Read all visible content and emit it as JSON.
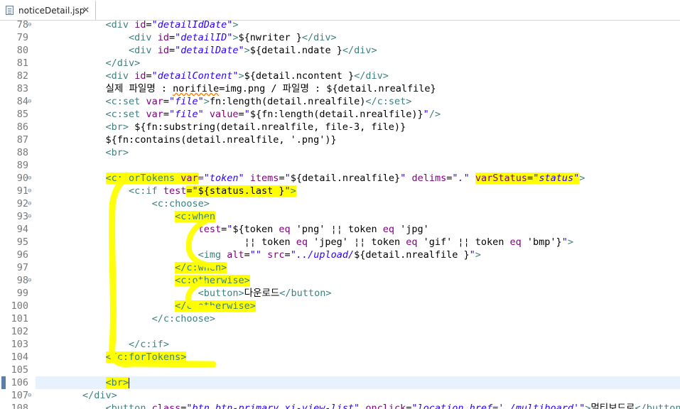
{
  "tab": {
    "title": "noticeDetail.jsp",
    "close": "✕",
    "icon": "jsp-file-icon"
  },
  "lines": [
    {
      "n": "78",
      "fold": true,
      "indent": "            ",
      "tokens": [
        [
          "tg",
          "<div "
        ],
        [
          "at",
          "id"
        ],
        [
          "el",
          "="
        ],
        [
          "sv",
          "\"detailIdDate\""
        ],
        [
          "tg",
          ">"
        ]
      ]
    },
    {
      "n": "79",
      "indent": "                ",
      "tokens": [
        [
          "tg",
          "<div "
        ],
        [
          "at",
          "id"
        ],
        [
          "el",
          "="
        ],
        [
          "sv",
          "\"detailID\""
        ],
        [
          "tg",
          ">"
        ],
        [
          "el",
          "${nwriter }"
        ],
        [
          "tg",
          "</div>"
        ]
      ]
    },
    {
      "n": "80",
      "indent": "                ",
      "tokens": [
        [
          "tg",
          "<div "
        ],
        [
          "at",
          "id"
        ],
        [
          "el",
          "="
        ],
        [
          "sv",
          "\"detailDate\""
        ],
        [
          "tg",
          ">"
        ],
        [
          "el",
          "${detail.ndate }"
        ],
        [
          "tg",
          "</div>"
        ]
      ]
    },
    {
      "n": "81",
      "indent": "            ",
      "tokens": [
        [
          "tg",
          "</div>"
        ]
      ]
    },
    {
      "n": "82",
      "indent": "            ",
      "tokens": [
        [
          "tg",
          "<div "
        ],
        [
          "at",
          "id"
        ],
        [
          "el",
          "="
        ],
        [
          "sv",
          "\"detailContent\""
        ],
        [
          "tg",
          ">"
        ],
        [
          "el",
          "${detail.ncontent }"
        ],
        [
          "tg",
          "</div>"
        ]
      ]
    },
    {
      "n": "83",
      "indent": "            ",
      "tokens": [
        [
          "el",
          "실제 파일명 : "
        ],
        [
          "el sq",
          "norifile"
        ],
        [
          "el",
          "=img.png / 파일명 : ${detail.nrealfile}"
        ]
      ]
    },
    {
      "n": "84",
      "fold": true,
      "indent": "            ",
      "tokens": [
        [
          "tg",
          "<c:set "
        ],
        [
          "at",
          "var"
        ],
        [
          "el",
          "="
        ],
        [
          "sv",
          "\"file\""
        ],
        [
          "tg",
          ">"
        ],
        [
          "el",
          "fn:length(detail.nrealfile)"
        ],
        [
          "tg",
          "</c:set>"
        ]
      ]
    },
    {
      "n": "85",
      "indent": "            ",
      "tokens": [
        [
          "tg",
          "<c:set "
        ],
        [
          "at",
          "var"
        ],
        [
          "el",
          "="
        ],
        [
          "sv",
          "\"file\""
        ],
        [
          "el",
          " "
        ],
        [
          "at",
          "value"
        ],
        [
          "el",
          "="
        ],
        [
          "sv",
          "\""
        ],
        [
          "el",
          "${fn:length(detail.nrealfile)}"
        ],
        [
          "sv",
          "\""
        ],
        [
          "tg",
          "/>"
        ]
      ]
    },
    {
      "n": "86",
      "indent": "            ",
      "tokens": [
        [
          "tg",
          "<br>"
        ],
        [
          "el",
          " ${fn:substring(detail.nrealfile, file-3, file)}"
        ]
      ]
    },
    {
      "n": "87",
      "indent": "            ",
      "tokens": [
        [
          "el",
          "${fn:contains(detail.nrealfile, '.png')}"
        ]
      ]
    },
    {
      "n": "88",
      "indent": "            ",
      "tokens": [
        [
          "tg",
          "<br>"
        ]
      ]
    },
    {
      "n": "89",
      "indent": "",
      "tokens": []
    },
    {
      "n": "90",
      "fold": true,
      "indent": "            ",
      "tokens": [
        [
          "tg hl",
          "<c:forTokens "
        ],
        [
          "at hl",
          "var"
        ],
        [
          "at",
          "="
        ],
        [
          "sv",
          "\"token\""
        ],
        [
          "el",
          " "
        ],
        [
          "at",
          "items"
        ],
        [
          "el",
          "="
        ],
        [
          "sv",
          "\""
        ],
        [
          "el",
          "${detail.nrealfile}"
        ],
        [
          "sv",
          "\""
        ],
        [
          "el",
          " "
        ],
        [
          "at",
          "delims"
        ],
        [
          "el",
          "="
        ],
        [
          "sv",
          "\".\""
        ],
        [
          "el",
          " "
        ],
        [
          "at hl",
          "varStatus"
        ],
        [
          "el hl",
          "="
        ],
        [
          "sv hl",
          "\"status\""
        ],
        [
          "tg",
          ">"
        ]
      ]
    },
    {
      "n": "91",
      "fold": true,
      "indent": "                ",
      "tokens": [
        [
          "tg",
          "<c:if "
        ],
        [
          "at",
          "test"
        ],
        [
          "el hl",
          "="
        ],
        [
          "sv hl",
          "\""
        ],
        [
          "el hl",
          "${status.last }"
        ],
        [
          "sv hl",
          "\""
        ],
        [
          "tg hl",
          ">"
        ]
      ]
    },
    {
      "n": "92",
      "fold": true,
      "indent": "                    ",
      "tokens": [
        [
          "tg",
          "<c:choose>"
        ]
      ]
    },
    {
      "n": "93",
      "fold": true,
      "indent": "                        ",
      "tokens": [
        [
          "tg hl",
          "<c:when"
        ]
      ]
    },
    {
      "n": "94",
      "indent": "                            ",
      "tokens": [
        [
          "at",
          "test"
        ],
        [
          "el",
          "="
        ],
        [
          "sv",
          "\""
        ],
        [
          "el",
          "${token "
        ],
        [
          "at",
          "eq"
        ],
        [
          "el",
          " 'png' ¦¦ token "
        ],
        [
          "at",
          "eq"
        ],
        [
          "el",
          " 'jpg'"
        ]
      ]
    },
    {
      "n": "95",
      "indent": "                                    ",
      "tokens": [
        [
          "el",
          "¦¦ token "
        ],
        [
          "at",
          "eq"
        ],
        [
          "el",
          " 'jpeg' ¦¦ token "
        ],
        [
          "at",
          "eq"
        ],
        [
          "el",
          " 'gif' ¦¦ token "
        ],
        [
          "at",
          "eq"
        ],
        [
          "el",
          " 'bmp'}"
        ],
        [
          "sv",
          "\""
        ],
        [
          "tg",
          ">"
        ]
      ]
    },
    {
      "n": "96",
      "indent": "                            ",
      "tokens": [
        [
          "tg",
          "<img "
        ],
        [
          "at",
          "alt"
        ],
        [
          "el",
          "="
        ],
        [
          "sv",
          "\"\""
        ],
        [
          "el",
          " "
        ],
        [
          "at",
          "src"
        ],
        [
          "el",
          "="
        ],
        [
          "sv",
          "\"../upload/"
        ],
        [
          "el",
          "${detail.nrealfile }"
        ],
        [
          "sv",
          "\""
        ],
        [
          "tg",
          ">"
        ]
      ]
    },
    {
      "n": "97",
      "indent": "                        ",
      "tokens": [
        [
          "tg hl",
          "</c:when>"
        ]
      ]
    },
    {
      "n": "98",
      "fold": true,
      "indent": "                        ",
      "tokens": [
        [
          "tg hl",
          "<c:otherwise>"
        ]
      ]
    },
    {
      "n": "99",
      "indent": "                            ",
      "tokens": [
        [
          "tg",
          "<button>"
        ],
        [
          "el",
          "다운로드"
        ],
        [
          "tg",
          "</button>"
        ]
      ]
    },
    {
      "n": "100",
      "indent": "                        ",
      "tokens": [
        [
          "tg hl",
          "</c:otherwise>"
        ]
      ]
    },
    {
      "n": "101",
      "indent": "                    ",
      "tokens": [
        [
          "tg",
          "</c:choose>"
        ]
      ]
    },
    {
      "n": "102",
      "indent": "",
      "tokens": []
    },
    {
      "n": "103",
      "indent": "                ",
      "tokens": [
        [
          "tg",
          "</c:if>"
        ]
      ]
    },
    {
      "n": "104",
      "indent": "            ",
      "tokens": [
        [
          "tg hl",
          "</c:forTokens>"
        ]
      ]
    },
    {
      "n": "105",
      "indent": "",
      "tokens": []
    },
    {
      "n": "106",
      "current": true,
      "caret": true,
      "indent": "            ",
      "tokens": [
        [
          "tg hl",
          "<br>"
        ]
      ]
    },
    {
      "n": "107",
      "fold": true,
      "indent": "        ",
      "tokens": [
        [
          "tg",
          "</div>"
        ]
      ]
    },
    {
      "n": "108",
      "indent": "            ",
      "tokens": [
        [
          "tg",
          "<button "
        ],
        [
          "at",
          "class"
        ],
        [
          "el",
          "="
        ],
        [
          "sv",
          "\"btn btn-primary xi-view-list\""
        ],
        [
          "el",
          " "
        ],
        [
          "at",
          "onclick"
        ],
        [
          "el",
          "="
        ],
        [
          "sv",
          "\"location.href='./multiboard'\""
        ],
        [
          "tg",
          ">"
        ],
        [
          "el",
          "멀티보드로"
        ],
        [
          "tg",
          "</button>"
        ]
      ]
    }
  ],
  "colors": {
    "tag": "#3f7f7f",
    "attr": "#7f007f",
    "string": "#2a00ff",
    "highlight": "#ffff00",
    "current_line": "#e8f2fe"
  }
}
